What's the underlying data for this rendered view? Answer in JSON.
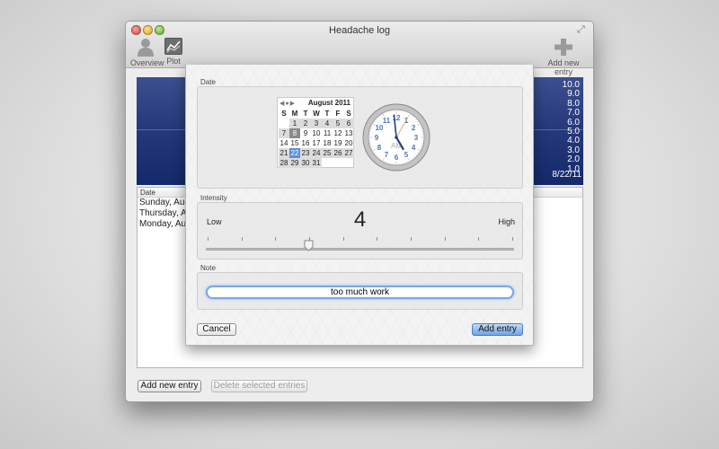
{
  "window": {
    "title": "Headache log"
  },
  "toolbar": {
    "overview_label": "Overview",
    "plot_label": "Plot",
    "add_label": "Add new entry"
  },
  "chart": {
    "y_ticks": [
      "10.0",
      "9.0",
      "8.0",
      "7.0",
      "6.0",
      "5.0",
      "4.0",
      "3.0",
      "2.0",
      "1.0"
    ],
    "x_date": "8/22/11",
    "colors": {
      "top": "#3c4f8f",
      "bottom": "#14296b"
    }
  },
  "list": {
    "header": "Date",
    "rows": [
      "Sunday, Augu",
      "Thursday, Aug",
      "Monday, Aug"
    ]
  },
  "bottom_buttons": {
    "add": "Add new entry",
    "delete": "Delete selected entries"
  },
  "sheet": {
    "date_label": "Date",
    "calendar": {
      "month_title": "August 2011",
      "weekdays": [
        "S",
        "M",
        "T",
        "W",
        "T",
        "F",
        "S"
      ],
      "weeks": [
        [
          "",
          "1",
          "2",
          "3",
          "4",
          "5",
          "6"
        ],
        [
          "7",
          "8",
          "9",
          "10",
          "11",
          "12",
          "13"
        ],
        [
          "14",
          "15",
          "16",
          "17",
          "18",
          "19",
          "20"
        ],
        [
          "21",
          "22",
          "23",
          "24",
          "25",
          "26",
          "27"
        ],
        [
          "28",
          "29",
          "30",
          "31",
          "",
          "",
          ""
        ]
      ],
      "selected_day": "22",
      "marked_day": "8"
    },
    "clock": {
      "numbers": [
        "12",
        "1",
        "2",
        "3",
        "4",
        "5",
        "6",
        "7",
        "8",
        "9",
        "10",
        "11"
      ],
      "period": "AM",
      "hour": 4,
      "minute": 59,
      "second": 5
    },
    "intensity_label": "Intensity",
    "intensity": {
      "low": "Low",
      "high": "High",
      "value": "4",
      "fraction": 0.333,
      "ticks": 10
    },
    "note_label": "Note",
    "note_value": "too much work",
    "cancel_label": "Cancel",
    "add_entry_label": "Add entry"
  }
}
